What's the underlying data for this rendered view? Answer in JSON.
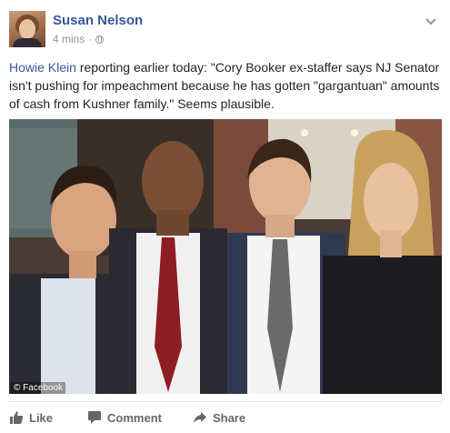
{
  "post": {
    "author": "Susan Nelson",
    "timestamp": "4 mins",
    "separator": "·",
    "privacy_icon": "globe-icon",
    "menu_icon": "chevron-down-icon"
  },
  "body": {
    "link_text": "Howie Klein",
    "text": " reporting earlier today: \"Cory Booker ex-staffer says NJ Senator isn't pushing for impeachment because he has gotten \"gargantuan\" amounts of cash from Kushner family.\" Seems plausible."
  },
  "photo": {
    "watermark": "© Facebook"
  },
  "actions": {
    "like_label": "Like",
    "comment_label": "Comment",
    "share_label": "Share"
  },
  "colors": {
    "link": "#365899",
    "meta": "#90949c",
    "action": "#606770"
  }
}
